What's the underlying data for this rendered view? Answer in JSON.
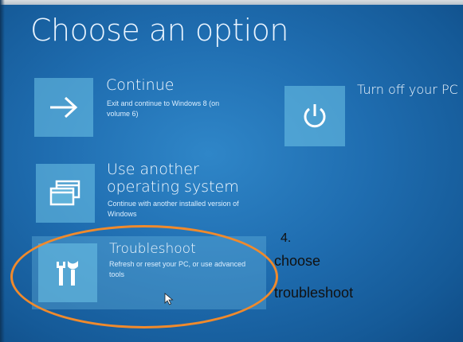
{
  "screen": {
    "title": "Choose an option",
    "options": [
      {
        "id": "continue",
        "icon": "arrow-right-icon",
        "title": "Continue",
        "description": "Exit and continue to Windows 8 (on volume 6)"
      },
      {
        "id": "turn-off",
        "icon": "power-icon",
        "title": "Turn off your PC",
        "description": ""
      },
      {
        "id": "use-another-os",
        "icon": "windows-stack-icon",
        "title_line1": "Use another",
        "title_line2": "operating system",
        "description": "Continue with another installed version of Windows"
      },
      {
        "id": "troubleshoot",
        "icon": "tools-icon",
        "title": "Troubleshoot",
        "description": "Refresh or reset your PC, or use advanced tools"
      }
    ]
  },
  "annotation": {
    "step_number": "4.",
    "line1": "choose",
    "line2": "troubleshoot",
    "ellipse_color": "#f08a2c"
  },
  "colors": {
    "background": "#1f6db0",
    "tile": "#70c4e8"
  }
}
